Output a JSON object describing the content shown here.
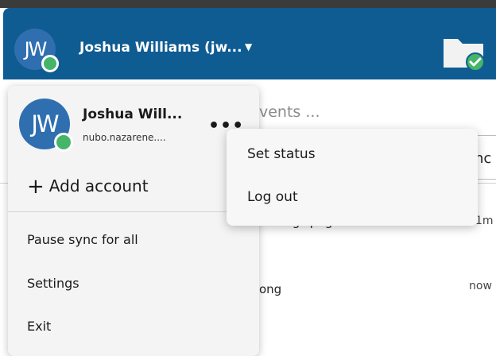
{
  "header": {
    "avatar_initials": "JW",
    "account_name": "Joshua Williams (jw...",
    "chevron_icon": "chevron-down-icon",
    "folder_icon": "folder-sync-ok-icon"
  },
  "account_menu": {
    "avatar_initials": "JW",
    "name": "Joshua Will...",
    "server": "nubo.nazarene....",
    "more_label": "•••",
    "add_account_label": "Add account",
    "items": [
      {
        "label": "Pause sync for all"
      },
      {
        "label": "Settings"
      },
      {
        "label": "Exit"
      }
    ]
  },
  "sub_menu": {
    "items": [
      {
        "label": "Set status"
      },
      {
        "label": "Log out"
      }
    ]
  },
  "background": {
    "search_placeholder": "vents ...",
    "sync_tab_label": "nc",
    "activities": [
      {
        "name": "vctangs.png",
        "time": "1m"
      },
      {
        "name": "ong",
        "time": "now"
      }
    ]
  },
  "colors": {
    "header_bg": "#0f5c92",
    "avatar_bg": "#2f6fb0",
    "online_status": "#45b56a",
    "menu_bg": "#f4f4f4"
  }
}
